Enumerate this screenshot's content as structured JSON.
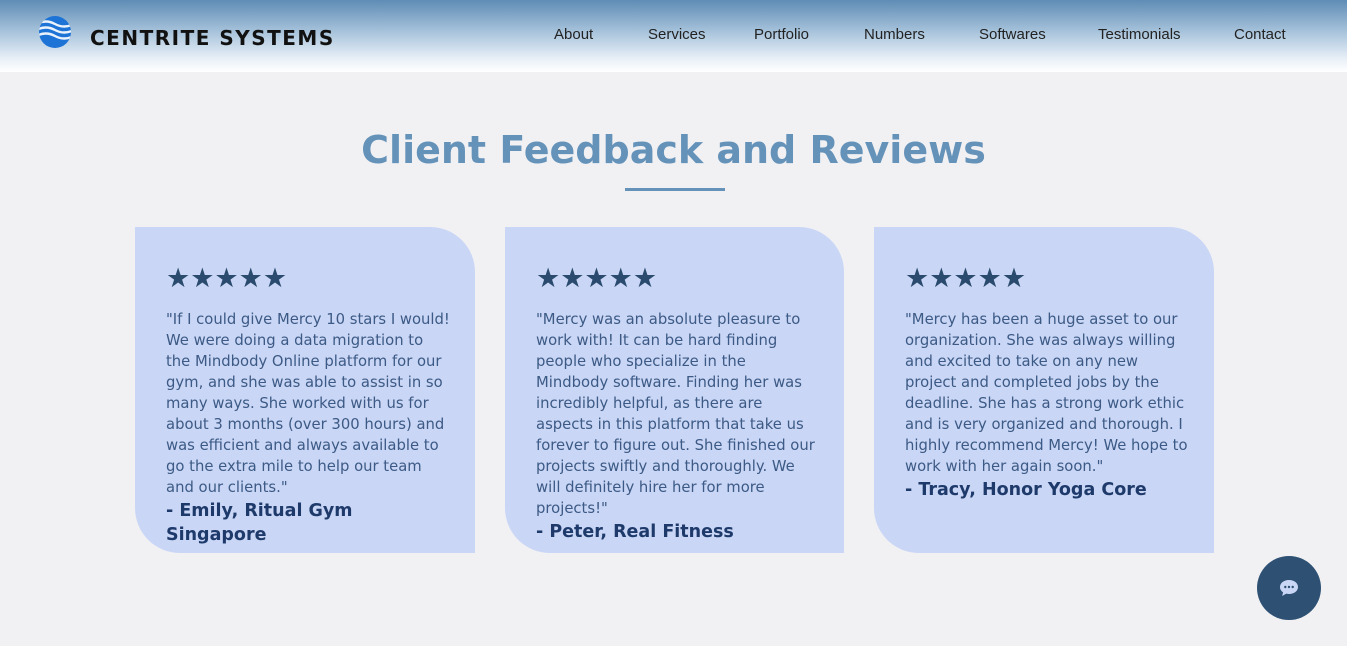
{
  "header": {
    "brand": "CENTRITE SYSTEMS",
    "nav": [
      "About",
      "Services",
      "Portfolio",
      "Numbers",
      "Softwares",
      "Testimonials",
      "Contact"
    ]
  },
  "section": {
    "title": "Client Feedback and Reviews"
  },
  "reviews": [
    {
      "stars": "★★★★★",
      "rating": 5,
      "quote": "\"If I could give Mercy 10 stars I would! We were doing a data migration to the Mindbody Online platform for our gym, and she was able to assist in so many ways. She worked with us for about 3 months (over 300 hours) and was efficient and always available to go the extra mile to help our team and our clients.\"",
      "author": "- Emily, Ritual Gym Singapore"
    },
    {
      "stars": "★★★★★",
      "rating": 5,
      "quote": "\"Mercy was an absolute pleasure to work with! It can be hard finding people who specialize in the Mindbody software. Finding her was incredibly helpful, as there are aspects in this platform that take us forever to figure out. She finished our projects swiftly and thoroughly. We will definitely hire her for more projects!\"",
      "author": "- Peter, Real Fitness"
    },
    {
      "stars": "★★★★★",
      "rating": 5,
      "quote": "\"Mercy has been a huge asset to our organization. She was always willing and excited to take on any new project and completed jobs by the deadline. She has a strong work ethic and is very organized and thorough. I highly recommend Mercy! We hope to work with her again soon.\"",
      "author": "- Tracy, Honor Yoga Core"
    }
  ],
  "chat": {
    "icon": "chat-bubble-icon"
  },
  "colors": {
    "accent": "#6592b8",
    "card_bg": "#c9d6f5",
    "chat_bg": "#2e5173",
    "star": "#2a4b6e"
  }
}
